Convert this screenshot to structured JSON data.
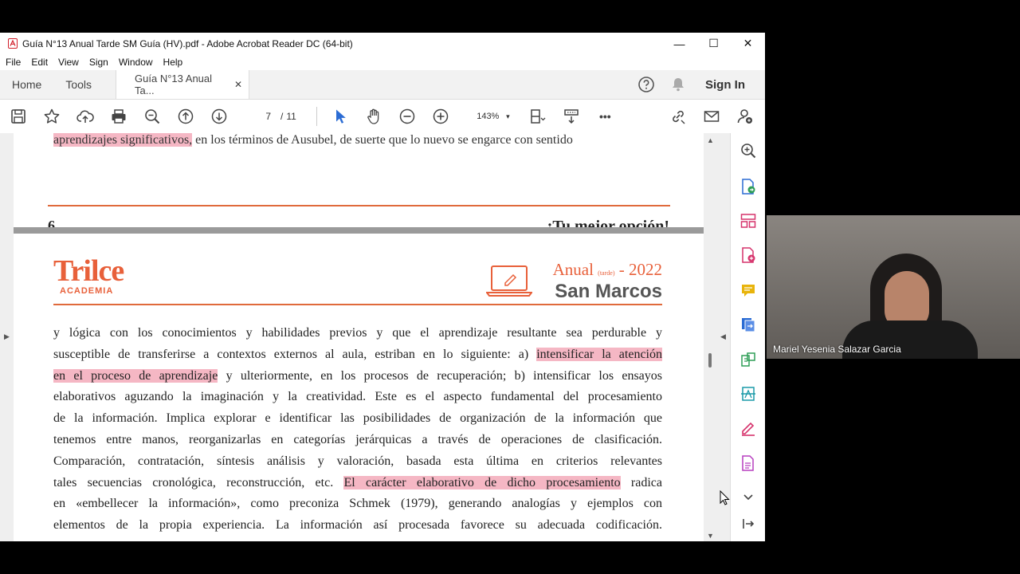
{
  "window": {
    "title": "Guía N°13 Anual Tarde SM Guía (HV).pdf - Adobe Acrobat Reader DC (64-bit)",
    "controls": {
      "minimize": "—",
      "maximize": "☐",
      "close": "✕"
    }
  },
  "menu": [
    "File",
    "Edit",
    "View",
    "Sign",
    "Window",
    "Help"
  ],
  "tabs": {
    "home": "Home",
    "tools": "Tools",
    "document": "Guía N°13 Anual Ta...",
    "document_close": "✕",
    "sign_in": "Sign In"
  },
  "toolbar": {
    "current_page": "7",
    "separator": "/",
    "total_pages": "11",
    "zoom": "143%",
    "zoom_caret": "▾",
    "more": "•••"
  },
  "document": {
    "prev_page_top_line": "aprendizajes significativos, en los términos de Ausubel, de suerte que lo nuevo se engarce con sentido",
    "page_number": "6",
    "slogan": "¡Tu mejor opción!",
    "logo_brand": "Trilce",
    "logo_sub": "ACADEMIA",
    "edition_line1": "Anual",
    "edition_small": "(tarde)",
    "edition_year": "- 2022",
    "edition_line2": "San Marcos",
    "lines": [
      {
        "pre": "y lógica con los conocimientos y habilidades previos y que el aprendizaje resultante sea perdurable y",
        "hl": "",
        "post": ""
      },
      {
        "pre": "susceptible de transferirse a contextos externos al aula, estriban en lo siguiente: a) ",
        "hl": "intensificar la atención",
        "post": ""
      },
      {
        "pre": "",
        "hl": "en el proceso de aprendizaje",
        "post": " y ulteriormente, en los procesos de recuperación; b) intensificar los ensayos"
      },
      {
        "pre": "elaborativos aguzando la imaginación y la creatividad. Este es el aspecto fundamental del procesamiento",
        "hl": "",
        "post": ""
      },
      {
        "pre": "de la información. Implica explorar e identificar las posibilidades de organización de la información que",
        "hl": "",
        "post": ""
      },
      {
        "pre": "tenemos entre manos, reorganizarlas en categorías jerárquicas a través de operaciones de clasificación.",
        "hl": "",
        "post": ""
      },
      {
        "pre": "Comparación, contratación, síntesis análisis y valoración, basada esta última en criterios relevantes",
        "hl": "",
        "post": ""
      },
      {
        "pre": "tales secuencias cronológica, reconstrucción, etc. ",
        "hl": "El carácter elaborativo de dicho procesamiento",
        "post": " radica"
      },
      {
        "pre": "en «embellecer la información», como preconiza Schmek (1979), generando analogías y ejemplos con",
        "hl": "",
        "post": ""
      },
      {
        "pre": "elementos de la propia experiencia. La información así procesada favorece su adecuada codificación.",
        "hl": "",
        "post": ""
      }
    ]
  },
  "video": {
    "participant_name": "Mariel Yesenia Salazar Garcia"
  },
  "colors": {
    "accent": "#e8603a",
    "highlight": "#f5b7c4",
    "tool_magenta": "#d6336c",
    "tool_blue": "#2b6cd4",
    "tool_green": "#2e9e57",
    "tool_yellow": "#e8b40c"
  }
}
